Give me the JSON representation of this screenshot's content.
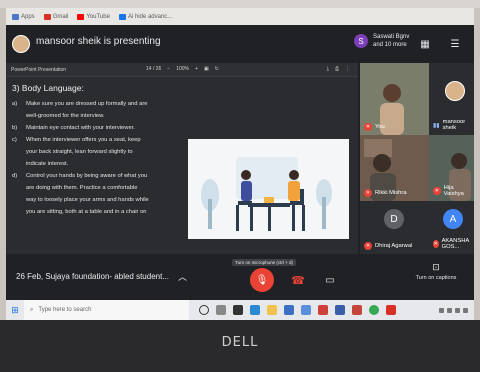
{
  "bookmarks": [
    {
      "label": "Apps",
      "color": "#4a78c7"
    },
    {
      "label": "Gmail",
      "color": "#d93025"
    },
    {
      "label": "YouTube",
      "color": "#ff0000"
    },
    {
      "label": "Ai hide advanc...",
      "color": "#1a73e8"
    }
  ],
  "meet": {
    "presenter_title": "mansoor sheik is presenting",
    "people_avatar_letter": "S",
    "people_line1": "Saswati Bgnv",
    "people_line2": "and 10 more"
  },
  "presentation": {
    "toolbar_title": "PowerPoint Presentation",
    "page_indicator": "14 / 26",
    "zoom_level": "100%",
    "heading": "3) Body Language:",
    "items": [
      {
        "marker": "a)",
        "text": "Make sure you are dressed up formally and are"
      },
      {
        "marker": "",
        "text": "well-groomed for the interview."
      },
      {
        "marker": "b)",
        "text": "Maintain eye contact with your interviewer."
      },
      {
        "marker": "c)",
        "text": "When the interviewer offers you a seat, keep"
      },
      {
        "marker": "",
        "text": "your back straight, lean forward slightly to"
      },
      {
        "marker": "",
        "text": "indicate interest."
      },
      {
        "marker": "d)",
        "text": "Control your hands by being aware of what you"
      },
      {
        "marker": "",
        "text": "are doing with them. Practice a comfortable"
      },
      {
        "marker": "",
        "text": "way to loosely place your arms and hands while"
      },
      {
        "marker": "",
        "text": "you are sitting, both at a table and in a chair on"
      }
    ]
  },
  "participants": [
    {
      "name": "You",
      "muted": true
    },
    {
      "name": "mansoor sheik",
      "muted": false
    },
    {
      "name": "Rikki Mishra",
      "muted": true
    },
    {
      "name": "Hija Vaishya",
      "muted": true
    },
    {
      "name": "Dhiraj Agarwal",
      "muted": true,
      "letter": "D",
      "color": "#5f6368"
    },
    {
      "name": "AKANSHA GOS...",
      "muted": true,
      "letter": "A",
      "color": "#4285f4"
    }
  ],
  "bottom": {
    "meeting_label": "26 Feb, Sujaya foundation- abled student...",
    "mic_tooltip": "Turn on microphone (ctrl + d)",
    "captions_label": "Turn on captions"
  },
  "taskbar": {
    "search_placeholder": "Type here to search"
  },
  "laptop": {
    "brand": "DELL"
  }
}
